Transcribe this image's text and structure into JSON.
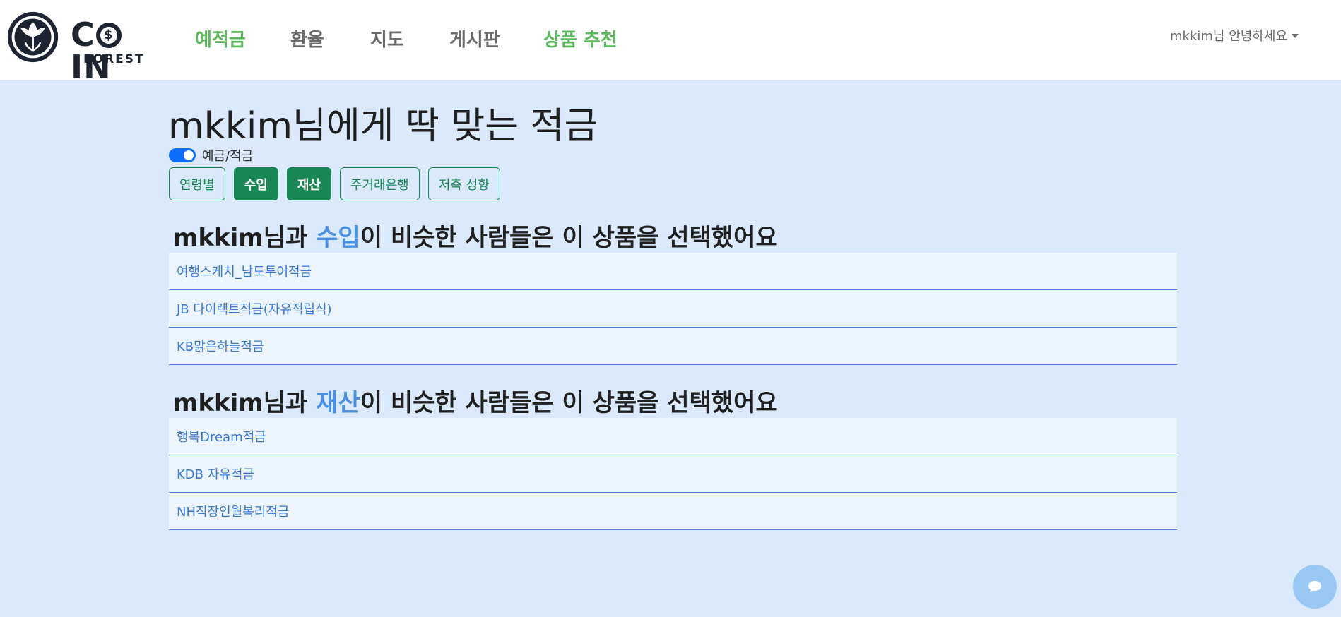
{
  "navbar": {
    "logo_word_c": "C",
    "logo_word_in": "IN",
    "logo_coin_symbol": "$",
    "logo_sub": "FOREST",
    "links": [
      {
        "label": "예적금",
        "active": true
      },
      {
        "label": "환율",
        "active": false
      },
      {
        "label": "지도",
        "active": false
      },
      {
        "label": "게시판",
        "active": false
      },
      {
        "label": "상품 추천",
        "active": true
      }
    ],
    "user_menu": "mkkim님 안녕하세요"
  },
  "page": {
    "title": "mkkim님에게 딱 맞는 적금",
    "toggle": {
      "label": "예금/적금",
      "checked": true
    },
    "filters": [
      {
        "label": "연령별",
        "active": false
      },
      {
        "label": "수입",
        "active": true
      },
      {
        "label": "재산",
        "active": true
      },
      {
        "label": "주거래은행",
        "active": false
      },
      {
        "label": "저축 성향",
        "active": false
      }
    ]
  },
  "sections": [
    {
      "prefix": "mkkim님과 ",
      "keyword": "수입",
      "suffix": "이 비슷한 사람들은 이 상품을 선택했어요",
      "products": [
        "여행스케치_남도투어적금",
        "JB 다이렉트적금(자유적립식)",
        "KB맑은하늘적금"
      ]
    },
    {
      "prefix": "mkkim님과 ",
      "keyword": "재산",
      "suffix": "이 비슷한 사람들은 이 상품을 선택했어요",
      "products": [
        "행복Dream적금",
        "KDB 자유적금",
        "NH직장인월복리적금"
      ]
    }
  ],
  "chat_button": {
    "icon": "chat-bubble-icon"
  },
  "colors": {
    "background": "#dbe9fc",
    "nav_active": "#5cb85c",
    "button_green": "#198754",
    "link_blue": "#3a78d6",
    "toggle_blue": "#0d6efd"
  }
}
